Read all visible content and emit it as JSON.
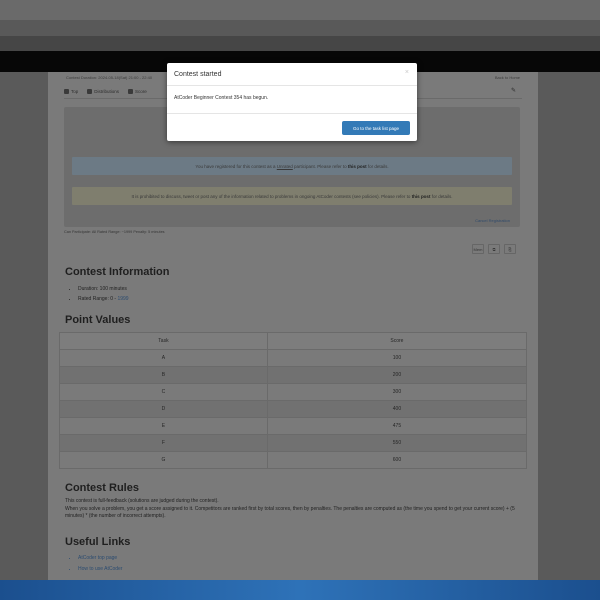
{
  "meta": {
    "contest_duration": "Contest Duration: 2024-05-18(Sat) 21:00 - 22:40",
    "back_home": "Back to Home"
  },
  "nav": {
    "items": [
      {
        "label": "Top",
        "icon": "home-icon"
      },
      {
        "label": "Distributions",
        "icon": "info-icon"
      },
      {
        "label": "Score",
        "icon": "edit-icon"
      }
    ],
    "pin_icon": "pin-icon"
  },
  "registration": {
    "info_prefix": "You have registered for this contest as a",
    "info_link": "Unrated",
    "info_suffix": "participant. Please refer to",
    "info_bold": "this post",
    "info_end": "for details.",
    "warn_prefix": "It is prohibited to discuss, tweet or post any of the information related to problems in ongoing AtCoder contests (see policies). Please refer to",
    "warn_bold": "this post",
    "warn_end": "for details.",
    "cancel": "Cancel Registration"
  },
  "stats_line": "Can Participate: All     Rated Range: ~1999     Penalty: 5 minutes",
  "toolbar": [
    "Mem",
    "⧉",
    "⎘"
  ],
  "contest_info": {
    "heading": "Contest Information",
    "duration": "Duration: 100 minutes",
    "rated_prefix": "Rated Range: 0 - ",
    "rated_value": "1999"
  },
  "point_values": {
    "heading": "Point Values",
    "headers": [
      "Task",
      "Score"
    ],
    "rows": [
      [
        "A",
        "100"
      ],
      [
        "B",
        "200"
      ],
      [
        "C",
        "300"
      ],
      [
        "D",
        "400"
      ],
      [
        "E",
        "475"
      ],
      [
        "F",
        "550"
      ],
      [
        "G",
        "600"
      ]
    ]
  },
  "contest_rules": {
    "heading": "Contest Rules",
    "line1": "This contest is full-feedback (solutions are judged during the contest).",
    "line2": "When you solve a problem, you get a score assigned to it. Competitors are ranked first by total scores, then by penalties. The penalties are computed as (the time you spend to get your current score) + (5 minutes) * (the number of incorrect attempts)."
  },
  "useful_links": {
    "heading": "Useful Links",
    "items": [
      "AtCoder top page",
      "How to use AtCoder"
    ]
  },
  "modal": {
    "title": "Contest started",
    "close": "×",
    "body": "AtCoder Beginner Contest 354 has begun.",
    "button": "Go to the task list page"
  }
}
